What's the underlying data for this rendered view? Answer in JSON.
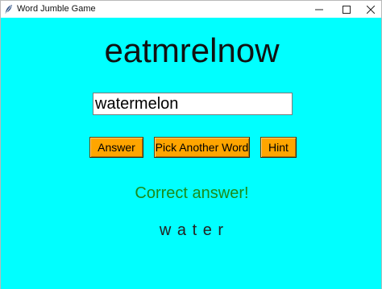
{
  "window": {
    "title": "Word Jumble Game",
    "app_icon": "feather-icon",
    "controls": [
      "minimize-icon",
      "maximize-icon",
      "close-icon"
    ]
  },
  "game": {
    "jumbled_word": "eatmrelnow",
    "answer_value": "watermelon",
    "buttons": {
      "answer_label": "Answer",
      "pick_label": "Pick Another Word",
      "hint_label": "Hint"
    },
    "status_text": "Correct answer!",
    "hint_text": "w a t e r"
  },
  "colors": {
    "background": "#00ffff",
    "button": "#ffa500",
    "status": "#1a8c1a"
  }
}
